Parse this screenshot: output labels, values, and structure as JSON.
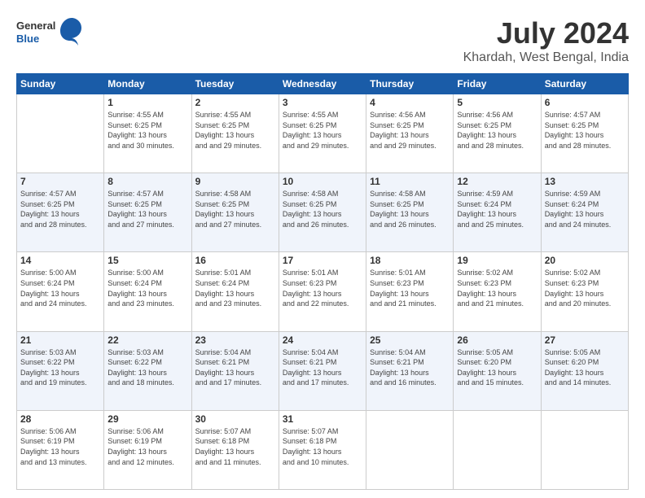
{
  "header": {
    "logo_line1": "General",
    "logo_line2": "Blue",
    "title": "July 2024",
    "location": "Khardah, West Bengal, India"
  },
  "weekdays": [
    "Sunday",
    "Monday",
    "Tuesday",
    "Wednesday",
    "Thursday",
    "Friday",
    "Saturday"
  ],
  "weeks": [
    [
      {
        "day": "",
        "sunrise": "",
        "sunset": "",
        "daylight": ""
      },
      {
        "day": "1",
        "sunrise": "Sunrise: 4:55 AM",
        "sunset": "Sunset: 6:25 PM",
        "daylight": "Daylight: 13 hours and 30 minutes."
      },
      {
        "day": "2",
        "sunrise": "Sunrise: 4:55 AM",
        "sunset": "Sunset: 6:25 PM",
        "daylight": "Daylight: 13 hours and 29 minutes."
      },
      {
        "day": "3",
        "sunrise": "Sunrise: 4:55 AM",
        "sunset": "Sunset: 6:25 PM",
        "daylight": "Daylight: 13 hours and 29 minutes."
      },
      {
        "day": "4",
        "sunrise": "Sunrise: 4:56 AM",
        "sunset": "Sunset: 6:25 PM",
        "daylight": "Daylight: 13 hours and 29 minutes."
      },
      {
        "day": "5",
        "sunrise": "Sunrise: 4:56 AM",
        "sunset": "Sunset: 6:25 PM",
        "daylight": "Daylight: 13 hours and 28 minutes."
      },
      {
        "day": "6",
        "sunrise": "Sunrise: 4:57 AM",
        "sunset": "Sunset: 6:25 PM",
        "daylight": "Daylight: 13 hours and 28 minutes."
      }
    ],
    [
      {
        "day": "7",
        "sunrise": "Sunrise: 4:57 AM",
        "sunset": "Sunset: 6:25 PM",
        "daylight": "Daylight: 13 hours and 28 minutes."
      },
      {
        "day": "8",
        "sunrise": "Sunrise: 4:57 AM",
        "sunset": "Sunset: 6:25 PM",
        "daylight": "Daylight: 13 hours and 27 minutes."
      },
      {
        "day": "9",
        "sunrise": "Sunrise: 4:58 AM",
        "sunset": "Sunset: 6:25 PM",
        "daylight": "Daylight: 13 hours and 27 minutes."
      },
      {
        "day": "10",
        "sunrise": "Sunrise: 4:58 AM",
        "sunset": "Sunset: 6:25 PM",
        "daylight": "Daylight: 13 hours and 26 minutes."
      },
      {
        "day": "11",
        "sunrise": "Sunrise: 4:58 AM",
        "sunset": "Sunset: 6:25 PM",
        "daylight": "Daylight: 13 hours and 26 minutes."
      },
      {
        "day": "12",
        "sunrise": "Sunrise: 4:59 AM",
        "sunset": "Sunset: 6:24 PM",
        "daylight": "Daylight: 13 hours and 25 minutes."
      },
      {
        "day": "13",
        "sunrise": "Sunrise: 4:59 AM",
        "sunset": "Sunset: 6:24 PM",
        "daylight": "Daylight: 13 hours and 24 minutes."
      }
    ],
    [
      {
        "day": "14",
        "sunrise": "Sunrise: 5:00 AM",
        "sunset": "Sunset: 6:24 PM",
        "daylight": "Daylight: 13 hours and 24 minutes."
      },
      {
        "day": "15",
        "sunrise": "Sunrise: 5:00 AM",
        "sunset": "Sunset: 6:24 PM",
        "daylight": "Daylight: 13 hours and 23 minutes."
      },
      {
        "day": "16",
        "sunrise": "Sunrise: 5:01 AM",
        "sunset": "Sunset: 6:24 PM",
        "daylight": "Daylight: 13 hours and 23 minutes."
      },
      {
        "day": "17",
        "sunrise": "Sunrise: 5:01 AM",
        "sunset": "Sunset: 6:23 PM",
        "daylight": "Daylight: 13 hours and 22 minutes."
      },
      {
        "day": "18",
        "sunrise": "Sunrise: 5:01 AM",
        "sunset": "Sunset: 6:23 PM",
        "daylight": "Daylight: 13 hours and 21 minutes."
      },
      {
        "day": "19",
        "sunrise": "Sunrise: 5:02 AM",
        "sunset": "Sunset: 6:23 PM",
        "daylight": "Daylight: 13 hours and 21 minutes."
      },
      {
        "day": "20",
        "sunrise": "Sunrise: 5:02 AM",
        "sunset": "Sunset: 6:23 PM",
        "daylight": "Daylight: 13 hours and 20 minutes."
      }
    ],
    [
      {
        "day": "21",
        "sunrise": "Sunrise: 5:03 AM",
        "sunset": "Sunset: 6:22 PM",
        "daylight": "Daylight: 13 hours and 19 minutes."
      },
      {
        "day": "22",
        "sunrise": "Sunrise: 5:03 AM",
        "sunset": "Sunset: 6:22 PM",
        "daylight": "Daylight: 13 hours and 18 minutes."
      },
      {
        "day": "23",
        "sunrise": "Sunrise: 5:04 AM",
        "sunset": "Sunset: 6:21 PM",
        "daylight": "Daylight: 13 hours and 17 minutes."
      },
      {
        "day": "24",
        "sunrise": "Sunrise: 5:04 AM",
        "sunset": "Sunset: 6:21 PM",
        "daylight": "Daylight: 13 hours and 17 minutes."
      },
      {
        "day": "25",
        "sunrise": "Sunrise: 5:04 AM",
        "sunset": "Sunset: 6:21 PM",
        "daylight": "Daylight: 13 hours and 16 minutes."
      },
      {
        "day": "26",
        "sunrise": "Sunrise: 5:05 AM",
        "sunset": "Sunset: 6:20 PM",
        "daylight": "Daylight: 13 hours and 15 minutes."
      },
      {
        "day": "27",
        "sunrise": "Sunrise: 5:05 AM",
        "sunset": "Sunset: 6:20 PM",
        "daylight": "Daylight: 13 hours and 14 minutes."
      }
    ],
    [
      {
        "day": "28",
        "sunrise": "Sunrise: 5:06 AM",
        "sunset": "Sunset: 6:19 PM",
        "daylight": "Daylight: 13 hours and 13 minutes."
      },
      {
        "day": "29",
        "sunrise": "Sunrise: 5:06 AM",
        "sunset": "Sunset: 6:19 PM",
        "daylight": "Daylight: 13 hours and 12 minutes."
      },
      {
        "day": "30",
        "sunrise": "Sunrise: 5:07 AM",
        "sunset": "Sunset: 6:18 PM",
        "daylight": "Daylight: 13 hours and 11 minutes."
      },
      {
        "day": "31",
        "sunrise": "Sunrise: 5:07 AM",
        "sunset": "Sunset: 6:18 PM",
        "daylight": "Daylight: 13 hours and 10 minutes."
      },
      {
        "day": "",
        "sunrise": "",
        "sunset": "",
        "daylight": ""
      },
      {
        "day": "",
        "sunrise": "",
        "sunset": "",
        "daylight": ""
      },
      {
        "day": "",
        "sunrise": "",
        "sunset": "",
        "daylight": ""
      }
    ]
  ]
}
